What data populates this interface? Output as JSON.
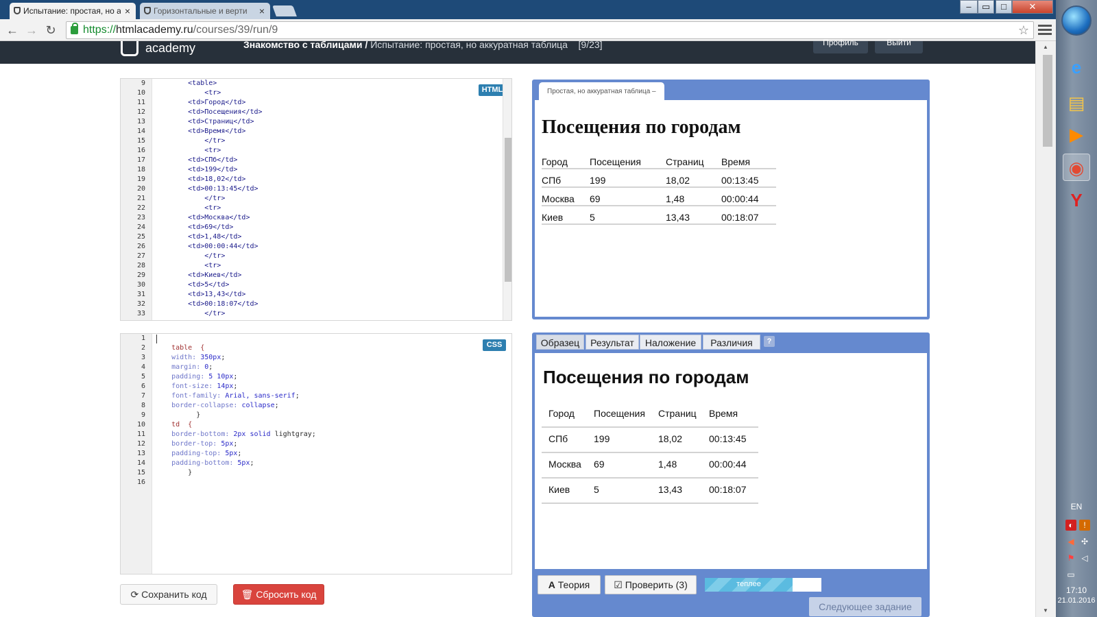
{
  "browser": {
    "tabs": [
      {
        "label": "Испытание: простая, но а",
        "active": true
      },
      {
        "label": "Горизонтальные и верти",
        "active": false
      }
    ],
    "url": {
      "scheme": "https://",
      "host": "htmlacademy.ru",
      "path": "/courses/39/run/9"
    }
  },
  "site": {
    "logo": "academy",
    "breadcrumb_section": "Знакомство с таблицами /",
    "breadcrumb_page": "Испытание: простая, но аккуратная таблица",
    "breadcrumb_count": "[9/23]",
    "profile_label": "Профиль",
    "logout_label": "Выйти"
  },
  "html_editor": {
    "badge": "HTML",
    "lines": [
      {
        "n": "9",
        "code": "        <table>"
      },
      {
        "n": "10",
        "code": "            <tr>"
      },
      {
        "n": "11",
        "code": "        <td>Город</td>"
      },
      {
        "n": "12",
        "code": "        <td>Посещения</td>"
      },
      {
        "n": "13",
        "code": "        <td>Страниц</td>"
      },
      {
        "n": "14",
        "code": "        <td>Время</td>"
      },
      {
        "n": "15",
        "code": "            </tr>"
      },
      {
        "n": "16",
        "code": "            <tr>"
      },
      {
        "n": "17",
        "code": "        <td>СПб</td>"
      },
      {
        "n": "18",
        "code": "        <td>199</td>"
      },
      {
        "n": "19",
        "code": "        <td>18,02</td>"
      },
      {
        "n": "20",
        "code": "        <td>00:13:45</td>"
      },
      {
        "n": "21",
        "code": "            </tr>"
      },
      {
        "n": "22",
        "code": "            <tr>"
      },
      {
        "n": "23",
        "code": "        <td>Москва</td>"
      },
      {
        "n": "24",
        "code": "        <td>69</td>"
      },
      {
        "n": "25",
        "code": "        <td>1,48</td>"
      },
      {
        "n": "26",
        "code": "        <td>00:00:44</td>"
      },
      {
        "n": "27",
        "code": "            </tr>"
      },
      {
        "n": "28",
        "code": "            <tr>"
      },
      {
        "n": "29",
        "code": "        <td>Киев</td>"
      },
      {
        "n": "30",
        "code": "        <td>5</td>"
      },
      {
        "n": "31",
        "code": "        <td>13,43</td>"
      },
      {
        "n": "32",
        "code": "        <td>00:18:07</td>"
      },
      {
        "n": "33",
        "code": "            </tr>"
      }
    ]
  },
  "css_editor": {
    "badge": "CSS",
    "lines": [
      {
        "n": "1",
        "sel": "",
        "prop": "",
        "val": "",
        "tail": ""
      },
      {
        "n": "2",
        "sel": "    table  {",
        "prop": "",
        "val": "",
        "tail": ""
      },
      {
        "n": "3",
        "sel": "",
        "prop": "    width",
        "val": " 350px",
        "tail": ";"
      },
      {
        "n": "4",
        "sel": "",
        "prop": "    margin",
        "val": " 0",
        "tail": ";"
      },
      {
        "n": "5",
        "sel": "",
        "prop": "    padding",
        "val": " 5 10px",
        "tail": ";"
      },
      {
        "n": "6",
        "sel": "",
        "prop": "    font-size",
        "val": " 14px",
        "tail": ";"
      },
      {
        "n": "7",
        "sel": "",
        "prop": "    font-family",
        "val": " Arial, sans-serif",
        "tail": ";"
      },
      {
        "n": "8",
        "sel": "",
        "prop": "    border-collapse",
        "val": " collapse",
        "tail": ";"
      },
      {
        "n": "9",
        "sel": "",
        "prop": "",
        "val": "",
        "tail": "          }"
      },
      {
        "n": "10",
        "sel": "    td  {",
        "prop": "",
        "val": "",
        "tail": ""
      },
      {
        "n": "11",
        "sel": "",
        "prop": "    border-bottom",
        "val": " 2px solid",
        "tail": " lightgray;"
      },
      {
        "n": "12",
        "sel": "",
        "prop": "    border-top",
        "val": " 5px",
        "tail": ";"
      },
      {
        "n": "13",
        "sel": "",
        "prop": "    padding-top",
        "val": " 5px",
        "tail": ";"
      },
      {
        "n": "14",
        "sel": "",
        "prop": "    padding-bottom",
        "val": " 5px",
        "tail": ";"
      },
      {
        "n": "15",
        "sel": "",
        "prop": "",
        "val": "",
        "tail": "        }"
      },
      {
        "n": "16",
        "sel": "",
        "prop": "",
        "val": "",
        "tail": ""
      }
    ]
  },
  "buttons": {
    "save": "Сохранить код",
    "reset": "Сбросить код"
  },
  "result_preview": {
    "tab_label": "Простая, но аккуратная таблица –",
    "heading": "Посещения по городам",
    "table": [
      [
        "Город",
        "Посещения",
        "Страниц",
        "Время"
      ],
      [
        "СПб",
        "199",
        "18,02",
        "00:13:45"
      ],
      [
        "Москва",
        "69",
        "1,48",
        "00:00:44"
      ],
      [
        "Киев",
        "5",
        "13,43",
        "00:18:07"
      ]
    ]
  },
  "sample_preview": {
    "tabs": [
      "Образец",
      "Результат",
      "Наложение",
      "Различия"
    ],
    "active_tab": "Образец",
    "help": "?",
    "heading": "Посещения по городам",
    "table": [
      [
        "Город",
        "Посещения",
        "Страниц",
        "Время"
      ],
      [
        "СПб",
        "199",
        "18,02",
        "00:13:45"
      ],
      [
        "Москва",
        "69",
        "1,48",
        "00:00:44"
      ],
      [
        "Киев",
        "5",
        "13,43",
        "00:18:07"
      ]
    ],
    "theory": "Теория",
    "check": "Проверить (3)",
    "hint": "теплее",
    "hint_progress": 0.75,
    "next": "Следующее задание"
  },
  "taskbar": {
    "lang": "EN",
    "time": "17:10",
    "date": "21.01.2016"
  }
}
